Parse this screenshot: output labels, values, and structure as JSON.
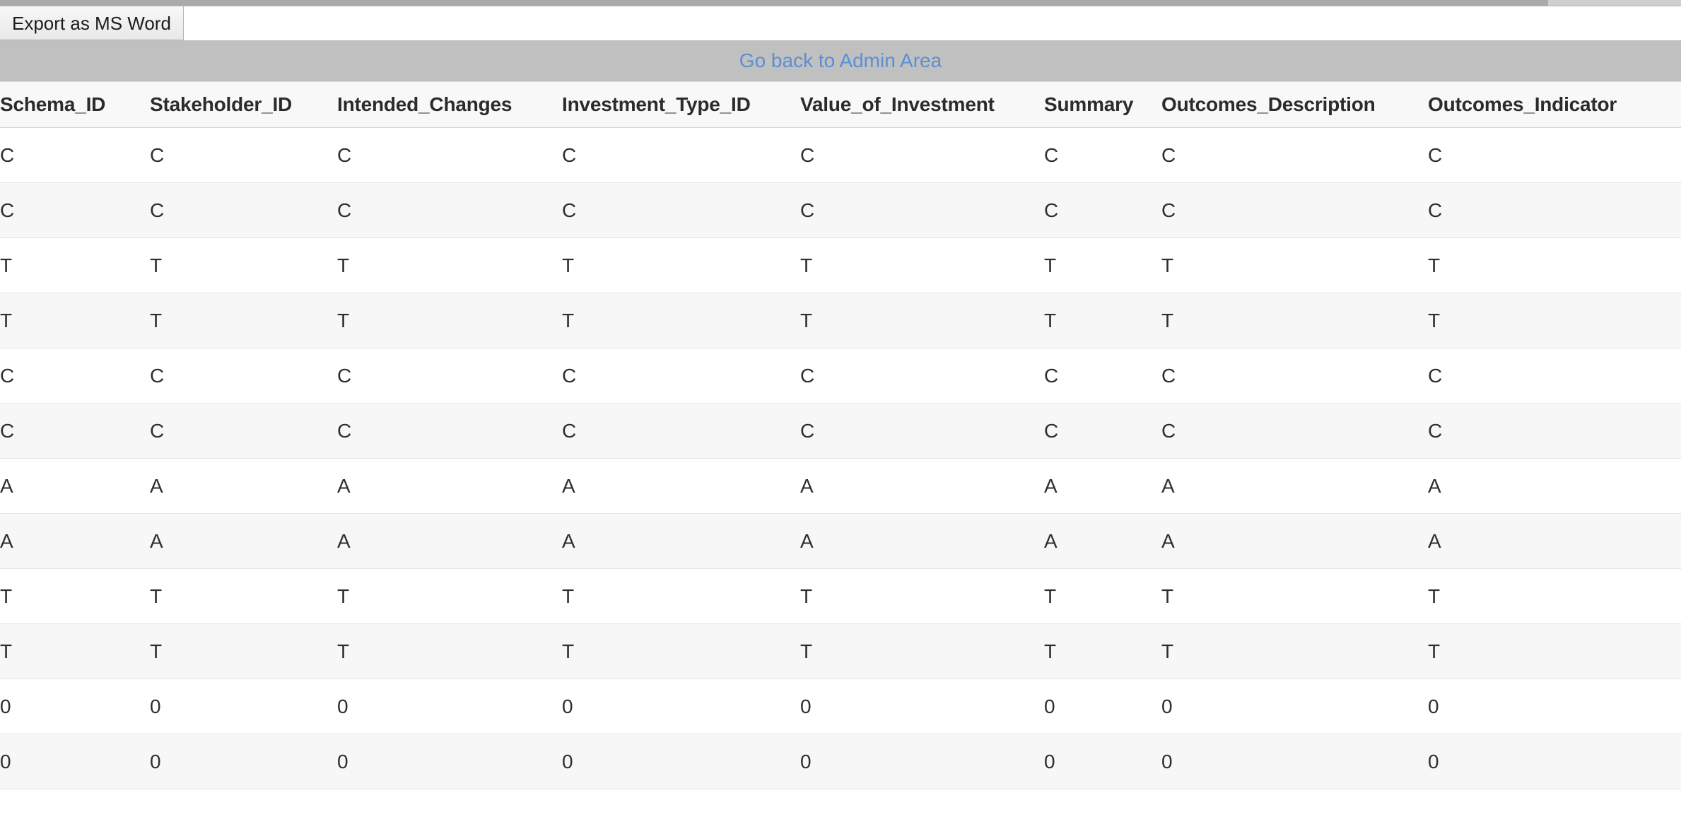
{
  "scrollbar": {
    "present": true
  },
  "toolbar": {
    "export_label": "Export as MS Word"
  },
  "admin_bar": {
    "link_label": "Go back to Admin Area",
    "link_color": "#5a8fd4",
    "background_color": "#c0c0c0"
  },
  "table": {
    "columns": [
      "Schema_ID",
      "Stakeholder_ID",
      "Intended_Changes",
      "Investment_Type_ID",
      "Value_of_Investment",
      "Summary",
      "Outcomes_Description",
      "Outcomes_Indicator"
    ],
    "rows": [
      [
        "C",
        "C",
        "C",
        "C",
        "C",
        "C",
        "C",
        "C"
      ],
      [
        "C",
        "C",
        "C",
        "C",
        "C",
        "C",
        "C",
        "C"
      ],
      [
        "T",
        "T",
        "T",
        "T",
        "T",
        "T",
        "T",
        "T"
      ],
      [
        "T",
        "T",
        "T",
        "T",
        "T",
        "T",
        "T",
        "T"
      ],
      [
        "C",
        "C",
        "C",
        "C",
        "C",
        "C",
        "C",
        "C"
      ],
      [
        "C",
        "C",
        "C",
        "C",
        "C",
        "C",
        "C",
        "C"
      ],
      [
        "A",
        "A",
        "A",
        "A",
        "A",
        "A",
        "A",
        "A"
      ],
      [
        "A",
        "A",
        "A",
        "A",
        "A",
        "A",
        "A",
        "A"
      ],
      [
        "T",
        "T",
        "T",
        "T",
        "T",
        "T",
        "T",
        "T"
      ],
      [
        "T",
        "T",
        "T",
        "T",
        "T",
        "T",
        "T",
        "T"
      ],
      [
        "0",
        "0",
        "0",
        "0",
        "0",
        "0",
        "0",
        "0"
      ],
      [
        "0",
        "0",
        "0",
        "0",
        "0",
        "0",
        "0",
        "0"
      ]
    ]
  }
}
